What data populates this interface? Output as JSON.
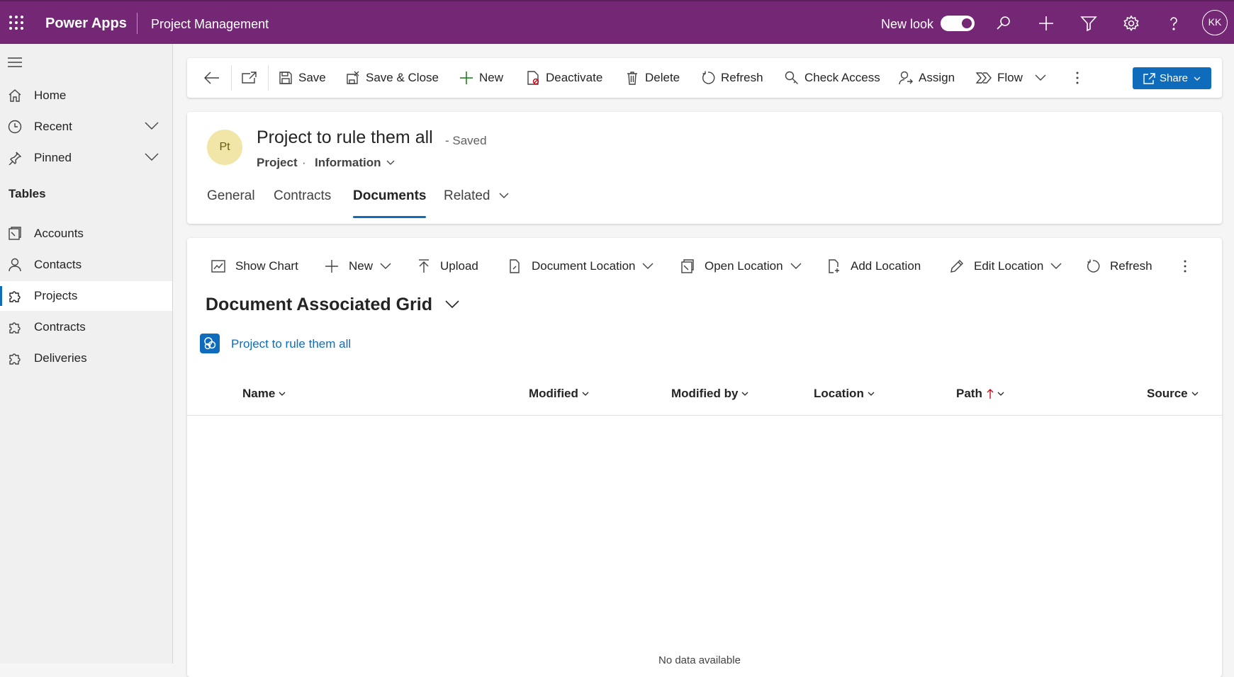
{
  "topbar": {
    "app_name": "Power Apps",
    "app_title": "Project Management",
    "new_look_label": "New look",
    "new_look_on": true,
    "user_initials": "KK",
    "icons": [
      "waffle-icon",
      "search-icon",
      "plus-icon",
      "filter-icon",
      "gear-icon",
      "help-icon"
    ],
    "background_color": "#742774"
  },
  "sidebar": {
    "items": [
      {
        "label": "Home",
        "icon": "home-icon"
      },
      {
        "label": "Recent",
        "icon": "clock-icon",
        "expandable": true
      },
      {
        "label": "Pinned",
        "icon": "pin-icon",
        "expandable": true
      }
    ],
    "section_title": "Tables",
    "tables": [
      {
        "label": "Accounts",
        "icon": "accounts-icon"
      },
      {
        "label": "Contacts",
        "icon": "person-icon"
      },
      {
        "label": "Projects",
        "icon": "puzzle-icon",
        "selected": true
      },
      {
        "label": "Contracts",
        "icon": "puzzle-icon"
      },
      {
        "label": "Deliveries",
        "icon": "puzzle-icon"
      }
    ]
  },
  "command_bar": {
    "save": "Save",
    "save_close": "Save & Close",
    "new": "New",
    "deactivate": "Deactivate",
    "delete": "Delete",
    "refresh": "Refresh",
    "check_access": "Check Access",
    "assign": "Assign",
    "flow": "Flow",
    "share": "Share"
  },
  "record": {
    "avatar_initials": "Pt",
    "title": "Project to rule them all",
    "status": "- Saved",
    "entity": "Project",
    "separator": "·",
    "form_selector": "Information",
    "tabs": [
      "General",
      "Contracts",
      "Documents",
      "Related"
    ],
    "active_tab": "Documents"
  },
  "grid": {
    "commands": {
      "show_chart": "Show Chart",
      "new": "New",
      "upload": "Upload",
      "document_location": "Document Location",
      "open_location": "Open Location",
      "add_location": "Add Location",
      "edit_location": "Edit Location",
      "refresh": "Refresh"
    },
    "view_title": "Document Associated Grid",
    "location_link": "Project to rule them all",
    "columns": [
      "Name",
      "Modified",
      "Modified by",
      "Location",
      "Path",
      "Source"
    ],
    "sorted_column": "Path",
    "sort_direction": "ascending",
    "empty_message": "No data available",
    "accent_color": "#0f6cbd"
  }
}
